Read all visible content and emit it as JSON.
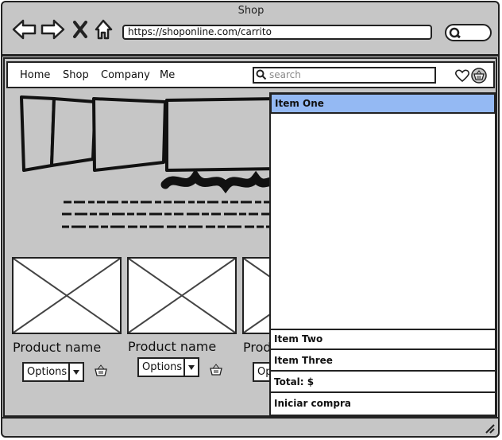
{
  "window": {
    "title": "Shop"
  },
  "browser": {
    "url": "https://shoponline.com/carrito"
  },
  "nav": {
    "links": [
      "Home",
      "Shop",
      "Company",
      "Me"
    ],
    "search_placeholder": "search"
  },
  "products": [
    {
      "name": "Product name",
      "options_label": "Options"
    },
    {
      "name": "Product name",
      "options_label": "Options"
    },
    {
      "name": "Product name",
      "options_label": "Options"
    }
  ],
  "cart_dropdown": {
    "selected_item": "Item One",
    "items": [
      "Item Two",
      "Item Three"
    ],
    "total_label": "Total: $",
    "checkout_label": "Iniciar compra"
  },
  "colors": {
    "selected": "#94b9f3",
    "background": "#c6c6c6"
  }
}
